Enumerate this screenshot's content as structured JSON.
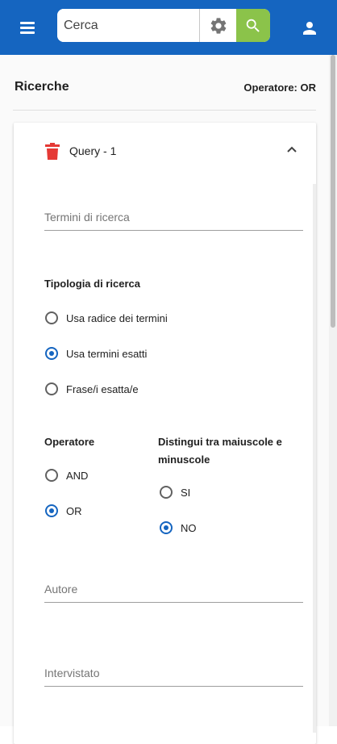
{
  "header": {
    "search_placeholder": "Cerca",
    "menu_icon": "hamburger-menu-icon",
    "settings_icon": "gear-icon",
    "search_icon": "magnifier-icon",
    "user_icon": "person-icon",
    "colors": {
      "appbar": "#1565c0",
      "search_button": "#8bc34a",
      "radio_selected": "#1565c0",
      "trash": "#e53935"
    }
  },
  "section": {
    "title": "Ricerche",
    "operator_label": "Operatore: OR"
  },
  "query": {
    "title": "Query - 1",
    "delete_icon": "trash-icon",
    "collapse_icon": "chevron-up-icon",
    "terms_placeholder": "Termini di ricerca",
    "search_type": {
      "label": "Tipologia di ricerca",
      "options": [
        "Usa radice dei termini",
        "Usa termini esatti",
        "Frase/i esatta/e"
      ],
      "selected": "Usa termini esatti"
    },
    "operator": {
      "label": "Operatore",
      "options": [
        "AND",
        "OR"
      ],
      "selected": "OR"
    },
    "case_sensitive": {
      "label": "Distingui tra maiuscole e minuscole",
      "options": [
        "SI",
        "NO"
      ],
      "selected": "NO"
    },
    "author_placeholder": "Autore",
    "interviewee_placeholder": "Intervistato"
  }
}
